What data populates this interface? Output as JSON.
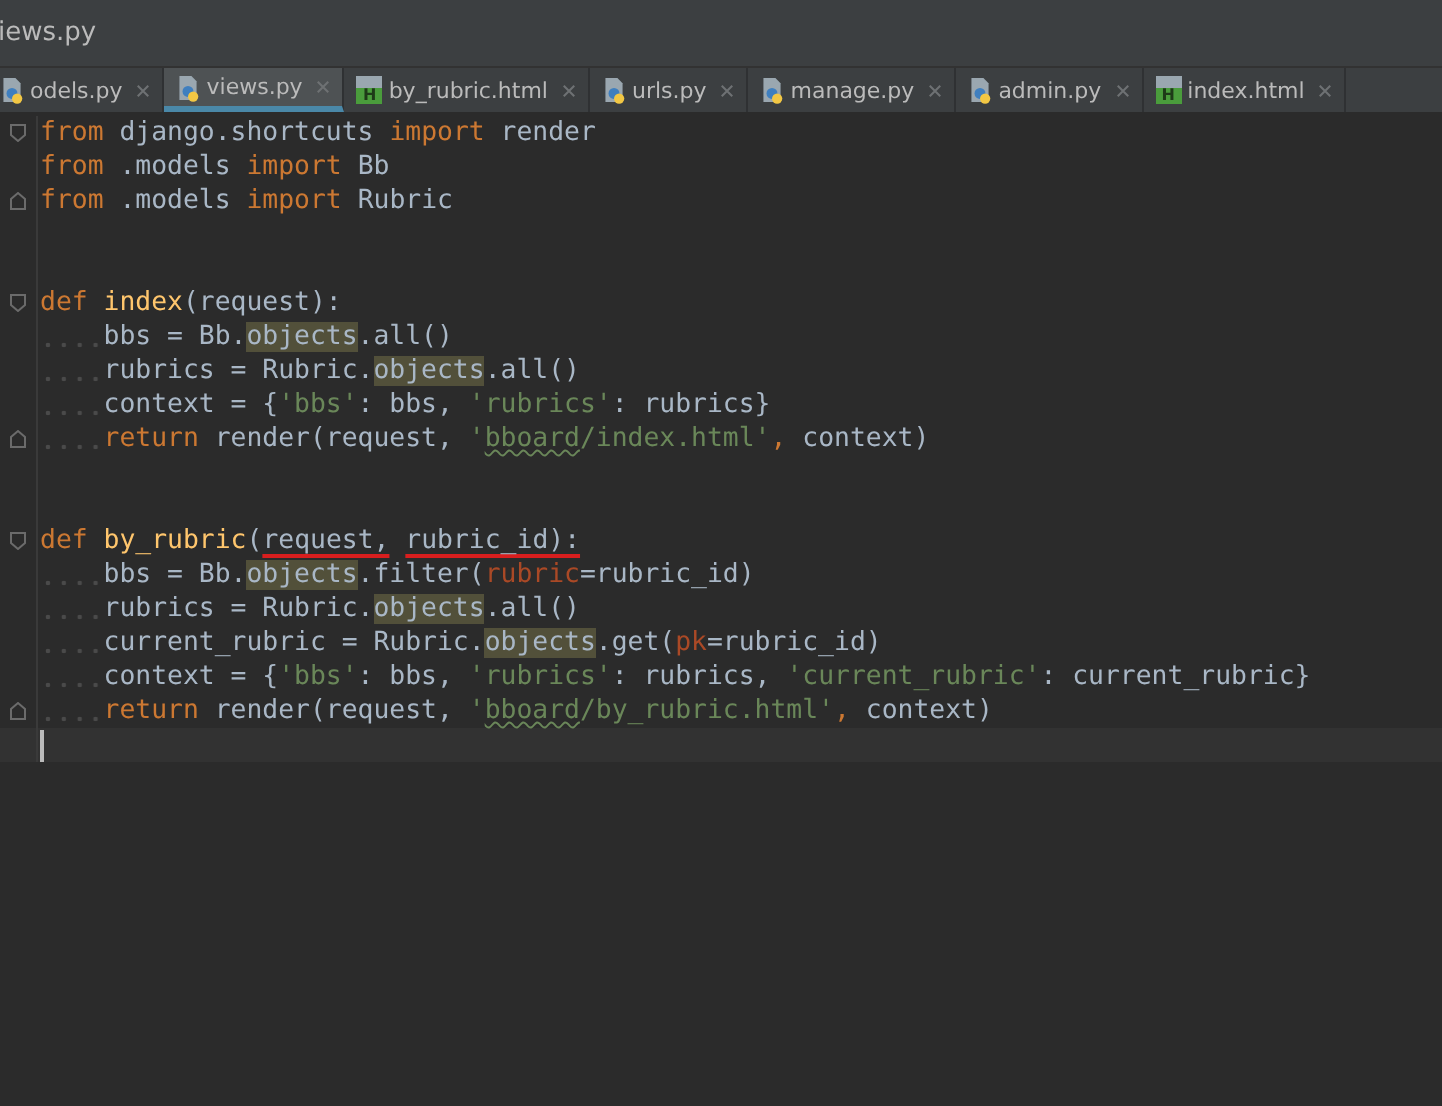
{
  "window": {
    "title": "iews.py"
  },
  "tabs": [
    {
      "label": "odels.py",
      "kind": "python",
      "selected": false
    },
    {
      "label": "views.py",
      "kind": "python",
      "selected": true
    },
    {
      "label": "by_rubric.html",
      "kind": "html",
      "badge": "H",
      "selected": false
    },
    {
      "label": "urls.py",
      "kind": "python",
      "selected": false
    },
    {
      "label": "manage.py",
      "kind": "python",
      "selected": false
    },
    {
      "label": "admin.py",
      "kind": "python",
      "selected": false
    },
    {
      "label": "index.html",
      "kind": "html",
      "badge": "H",
      "selected": false
    }
  ],
  "editor": {
    "blocks": [
      {
        "kind": "statements",
        "lines": [
          {
            "tokens": [
              {
                "kind": "keyword",
                "text": "from"
              },
              {
                "kind": "plain",
                "text": " django.shortcuts "
              },
              {
                "kind": "keyword",
                "text": "import"
              },
              {
                "kind": "plain",
                "text": " render"
              }
            ]
          },
          {
            "tokens": [
              {
                "kind": "keyword",
                "text": "from"
              },
              {
                "kind": "plain",
                "text": " .models "
              },
              {
                "kind": "keyword",
                "text": "import"
              },
              {
                "kind": "plain",
                "text": " Bb"
              }
            ]
          },
          {
            "tokens": [
              {
                "kind": "keyword",
                "text": "from"
              },
              {
                "kind": "plain",
                "text": " .models "
              },
              {
                "kind": "keyword",
                "text": "import"
              },
              {
                "kind": "plain",
                "text": " Rubric"
              }
            ]
          }
        ]
      },
      {
        "kind": "blank"
      },
      {
        "kind": "blank"
      },
      {
        "kind": "function",
        "header": {
          "tokens": [
            {
              "kind": "keyword",
              "text": "def "
            },
            {
              "kind": "function",
              "text": "index"
            },
            {
              "kind": "plain",
              "text": "(request):"
            }
          ]
        },
        "children": [
          {
            "tokens": [
              {
                "kind": "plain",
                "text": "bbs = Bb."
              },
              {
                "kind": "highlight",
                "text": "objects"
              },
              {
                "kind": "plain",
                "text": ".all()"
              }
            ]
          },
          {
            "tokens": [
              {
                "kind": "plain",
                "text": "rubrics = Rubric."
              },
              {
                "kind": "highlight",
                "text": "objects"
              },
              {
                "kind": "plain",
                "text": ".all()"
              }
            ]
          },
          {
            "tokens": [
              {
                "kind": "plain",
                "text": "context = {"
              },
              {
                "kind": "string",
                "text": "'bbs'"
              },
              {
                "kind": "plain",
                "text": ": bbs, "
              },
              {
                "kind": "string",
                "text": "'rubrics'"
              },
              {
                "kind": "plain",
                "text": ": rubrics}"
              }
            ]
          },
          {
            "tokens": [
              {
                "kind": "keyword",
                "text": "return"
              },
              {
                "kind": "plain",
                "text": " render(request, "
              },
              {
                "kind": "string",
                "text": "'"
              },
              {
                "kind": "typo",
                "text": "bboard"
              },
              {
                "kind": "string",
                "text": "/index.html'"
              },
              {
                "kind": "keyword",
                "text": ","
              },
              {
                "kind": "plain",
                "text": " context)"
              }
            ]
          }
        ]
      },
      {
        "kind": "blank"
      },
      {
        "kind": "blank"
      },
      {
        "kind": "function",
        "header": {
          "tokens": [
            {
              "kind": "keyword",
              "text": "def "
            },
            {
              "kind": "function",
              "text": "by_rubric"
            },
            {
              "kind": "plain",
              "text": "("
            },
            {
              "kind": "scribbled",
              "text": "request,"
            },
            {
              "kind": "scribbled",
              "text": " rubric_id):"
            }
          ]
        },
        "children": [
          {
            "tokens": [
              {
                "kind": "plain",
                "text": "bbs = Bb."
              },
              {
                "kind": "highlight",
                "text": "objects"
              },
              {
                "kind": "plain",
                "text": ".filter("
              },
              {
                "kind": "param",
                "text": "rubric"
              },
              {
                "kind": "plain",
                "text": "=rubric_id)"
              }
            ]
          },
          {
            "tokens": [
              {
                "kind": "plain",
                "text": "rubrics = Rubric."
              },
              {
                "kind": "highlight",
                "text": "objects"
              },
              {
                "kind": "plain",
                "text": ".all()"
              }
            ]
          },
          {
            "tokens": [
              {
                "kind": "plain",
                "text": "current_rubric = Rubric."
              },
              {
                "kind": "highlight",
                "text": "objects"
              },
              {
                "kind": "plain",
                "text": ".get("
              },
              {
                "kind": "param",
                "text": "pk"
              },
              {
                "kind": "plain",
                "text": "=rubric_id)"
              }
            ]
          },
          {
            "tokens": [
              {
                "kind": "plain",
                "text": "context = {"
              },
              {
                "kind": "string",
                "text": "'bbs'"
              },
              {
                "kind": "plain",
                "text": ": bbs, "
              },
              {
                "kind": "string",
                "text": "'rubrics'"
              },
              {
                "kind": "plain",
                "text": ": rubrics, "
              },
              {
                "kind": "string",
                "text": "'current_rubric'"
              },
              {
                "kind": "plain",
                "text": ": current_rubric}"
              }
            ]
          },
          {
            "tokens": [
              {
                "kind": "keyword",
                "text": "return"
              },
              {
                "kind": "plain",
                "text": " render(request, "
              },
              {
                "kind": "string",
                "text": "'"
              },
              {
                "kind": "typo",
                "text": "bboard"
              },
              {
                "kind": "string",
                "text": "/by_rubric.html'"
              },
              {
                "kind": "keyword",
                "text": ","
              },
              {
                "kind": "plain",
                "text": " context)"
              }
            ]
          }
        ]
      },
      {
        "kind": "cursor"
      }
    ]
  }
}
